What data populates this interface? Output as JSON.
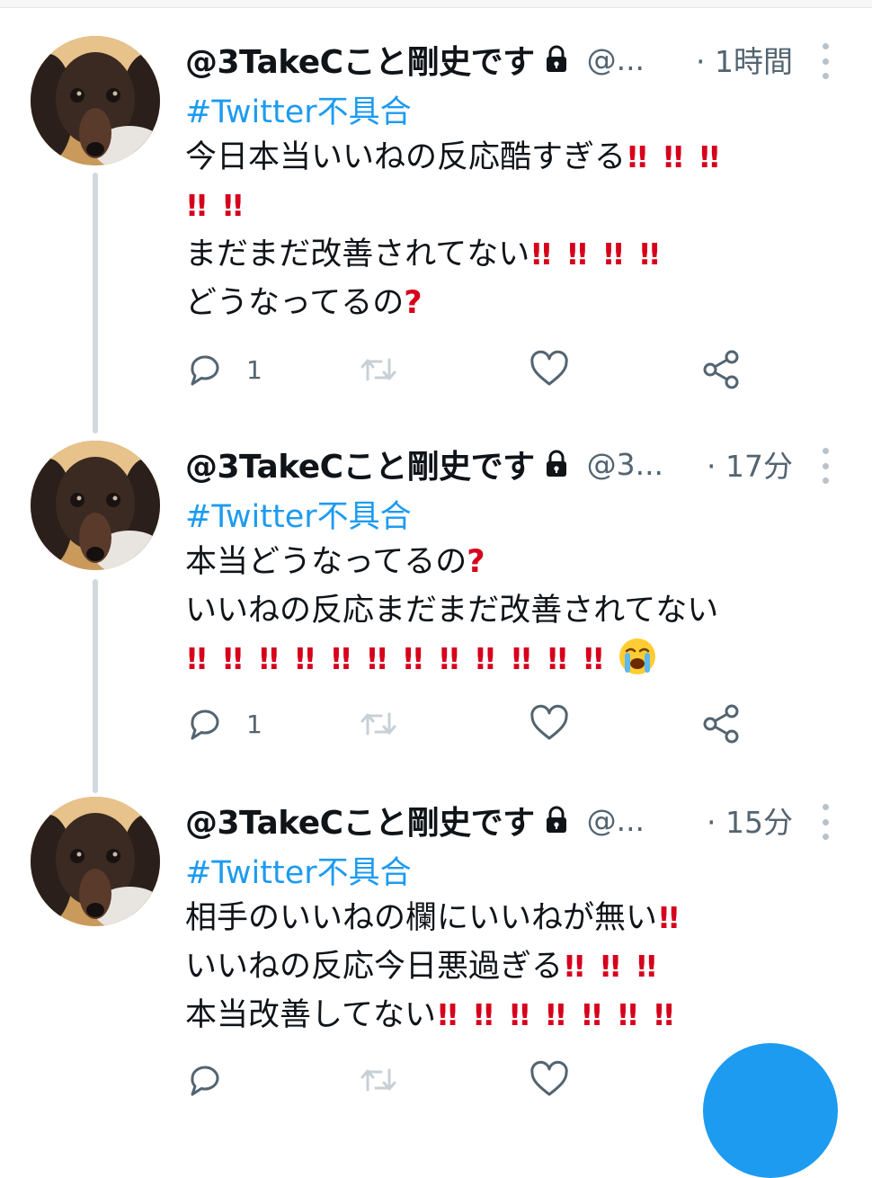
{
  "tweets": [
    {
      "name": "@3TakeCこと剛史です",
      "handle": "@...",
      "time": "· 1時間",
      "hashtag": "#Twitter不具合",
      "lines": [
        {
          "text": "今日本当いいねの反応酷すぎる",
          "excl": 3
        },
        {
          "text": "",
          "excl": 2
        },
        {
          "text": "まだまだ改善されてない",
          "excl": 4
        },
        {
          "text": "どうなってるの",
          "question": true
        }
      ],
      "reply_count": "1"
    },
    {
      "name": "@3TakeCこと剛史です",
      "handle": "@3...",
      "time": "· 17分",
      "hashtag": "#Twitter不具合",
      "lines": [
        {
          "text": "本当どうなってるの",
          "question": true
        },
        {
          "text": "いいねの反応まだまだ改善されてない"
        },
        {
          "text": "",
          "excl": 12,
          "emoji": "loudly-crying-face"
        }
      ],
      "reply_count": "1"
    },
    {
      "name": "@3TakeCこと剛史です",
      "handle": "@...",
      "time": "· 15分",
      "hashtag": "#Twitter不具合",
      "lines": [
        {
          "text": "相手のいいねの欄にいいねが無い",
          "excl": 1
        },
        {
          "text": "いいねの反応今日悪過ぎる",
          "excl": 3
        },
        {
          "text": "本当改善してない",
          "excl": 7
        }
      ],
      "reply_count": ""
    }
  ],
  "colors": {
    "accent": "#1d9bf0",
    "text": "#0f1419",
    "muted": "#536471",
    "emphasis": "#d6001c",
    "thread_line": "#cfd9de"
  },
  "icons": {
    "lock": "lock-icon",
    "reply": "reply-icon",
    "retweet": "retweet-icon",
    "like": "heart-icon",
    "share": "share-icon",
    "more": "more-vertical-icon",
    "compose": "compose-fab"
  }
}
